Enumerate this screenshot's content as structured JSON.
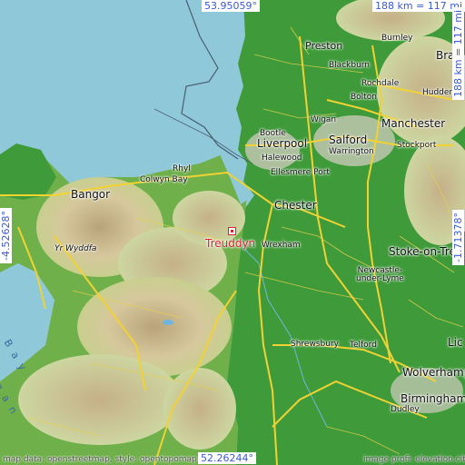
{
  "map": {
    "poi": {
      "name": "Treuddyn"
    },
    "coords": {
      "top": "53.95059°",
      "bottom": "52.26244°",
      "left": "-4.52628°",
      "right": "-1.71378°"
    },
    "scale": {
      "top": "188 km = 117 mi",
      "right": "188 km = 117 mi"
    },
    "places": {
      "preston": "Preston",
      "burnley": "Burnley",
      "blackburn": "Blackburn",
      "bra": "Bra",
      "rochdale": "Rochdale",
      "bolton": "Bolton",
      "huddersfield": "Hudderst",
      "bootle": "Bootle",
      "wigan": "Wigan",
      "manchester": "Manchester",
      "liverpool": "Liverpool",
      "salford": "Salford",
      "stockport": "Stockport",
      "halewood": "Halewood",
      "warrington": "Warrington",
      "rhyl": "Rhyl",
      "colwyn_bay": "Colwyn Bay",
      "ellesmere_port": "Ellesmere Port",
      "bangor": "Bangor",
      "chester": "Chester",
      "yr_wyddfa": "Yr Wyddfa",
      "wrexham": "Wrexham",
      "stoke": "Stoke-on-Tre",
      "newcastle": "Newcastle-\nunder-Lyme",
      "shrewsbury": "Shrewsbury",
      "telford": "Telford",
      "lic": "Lic",
      "wolverhampton": "Wolverhampt",
      "birmingham": "Birmingham",
      "dudley": "Dudley",
      "bay": "Bay",
      "gan": "gan"
    },
    "credits": {
      "left": "map data: openstreetmap, style: opentopomap",
      "right": "image profi: elevation.city"
    },
    "colors": {
      "sea": "#8ec8d9",
      "lowland": "#3f9b3a",
      "hills": "#d8c99a",
      "roads": "#f2d233",
      "poi": "#d8232a",
      "coord_text": "#3a5bcf"
    }
  }
}
